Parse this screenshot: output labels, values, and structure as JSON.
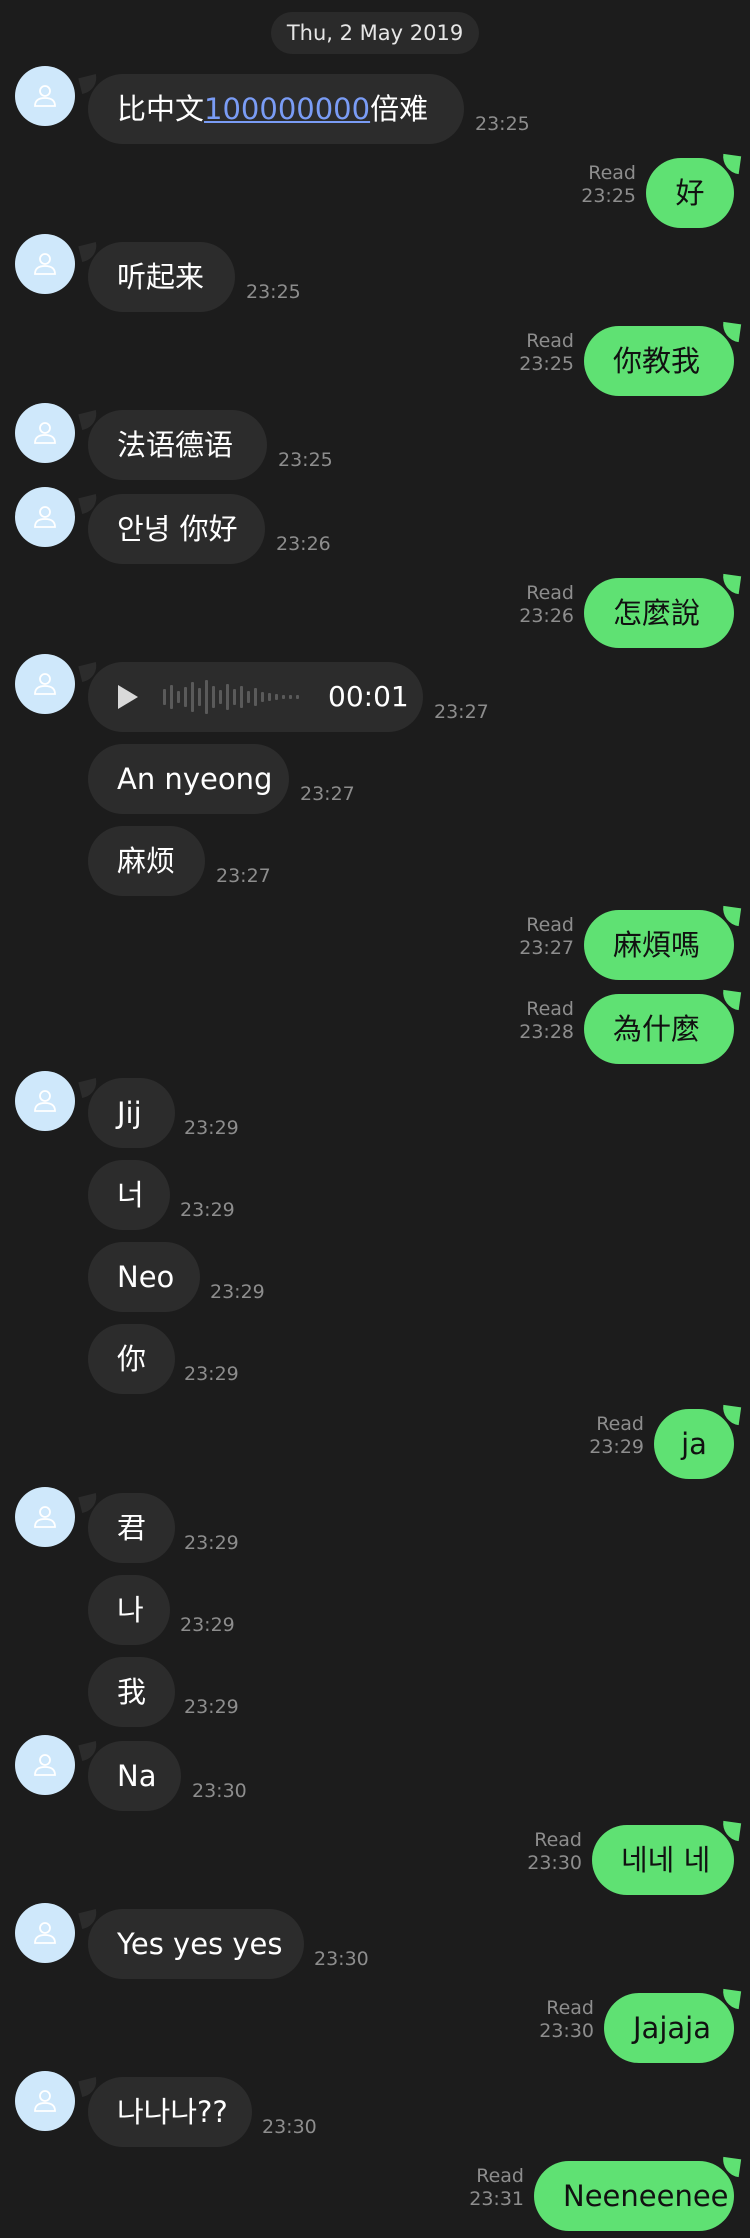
{
  "date": "Thu, 2 May 2019",
  "avatar_icon": "user-icon",
  "colors": {
    "background": "#1c1c1c",
    "incoming": "#2c2c2c",
    "outgoing": "#5fe173",
    "avatar": "#cfe8fb",
    "link": "#7a9cf5"
  },
  "messages": [
    {
      "pre": "比中文",
      "link": "100000000",
      "post": "倍难",
      "time": "23:25"
    },
    {
      "text": "好",
      "read": "Read",
      "time": "23:25"
    },
    {
      "text": "听起来",
      "time": "23:25"
    },
    {
      "text": "你教我",
      "read": "Read",
      "time": "23:25"
    },
    {
      "text": "法语德语",
      "time": "23:25"
    },
    {
      "text": "안녕 你好",
      "time": "23:26"
    },
    {
      "text": "怎麼說",
      "read": "Read",
      "time": "23:26"
    },
    {
      "voice_duration": "00:01",
      "time": "23:27"
    },
    {
      "text": "An nyeong",
      "time": "23:27"
    },
    {
      "text": "麻烦",
      "time": "23:27"
    },
    {
      "text": "麻煩嗎",
      "read": "Read",
      "time": "23:27"
    },
    {
      "text": "為什麼",
      "read": "Read",
      "time": "23:28"
    },
    {
      "text": "Jij",
      "time": "23:29"
    },
    {
      "text": "너",
      "time": "23:29"
    },
    {
      "text": "Neo",
      "time": "23:29"
    },
    {
      "text": "你",
      "time": "23:29"
    },
    {
      "text": "ja",
      "read": "Read",
      "time": "23:29"
    },
    {
      "text": "君",
      "time": "23:29"
    },
    {
      "text": "나",
      "time": "23:29"
    },
    {
      "text": "我",
      "time": "23:29"
    },
    {
      "text": "Na",
      "time": "23:30"
    },
    {
      "text": "네네 네",
      "read": "Read",
      "time": "23:30"
    },
    {
      "text": "Yes yes yes",
      "time": "23:30"
    },
    {
      "text": "Jajaja",
      "read": "Read",
      "time": "23:30"
    },
    {
      "text": "나나나??",
      "time": "23:30"
    },
    {
      "text": "Neeneenee",
      "read": "Read",
      "time": "23:31"
    }
  ]
}
